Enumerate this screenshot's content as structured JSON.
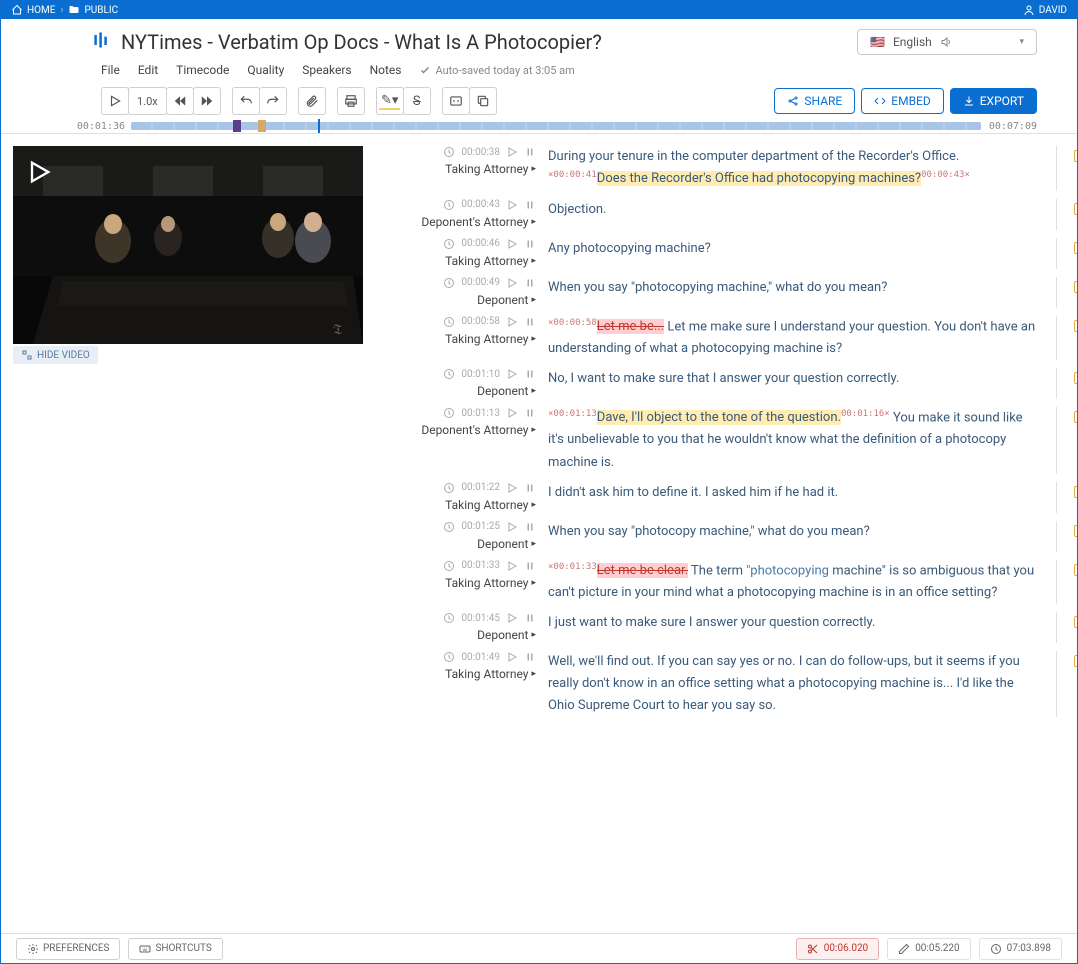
{
  "topbar": {
    "home": "HOME",
    "public": "PUBLIC",
    "user": "DAVID"
  },
  "header": {
    "title": "NYTimes - Verbatim Op Docs - What Is A Photocopier?",
    "language": "English",
    "menu": {
      "file": "File",
      "edit": "Edit",
      "timecode": "Timecode",
      "quality": "Quality",
      "speakers": "Speakers",
      "notes": "Notes"
    },
    "autosave": "Auto-saved today at 3:05 am",
    "speed": "1.0x",
    "actions": {
      "share": "SHARE",
      "embed": "EMBED",
      "export": "EXPORT"
    }
  },
  "timeline": {
    "current": "00:01:36",
    "duration": "00:07:09"
  },
  "video": {
    "hide": "HIDE VIDEO"
  },
  "segments": [
    {
      "tc": "00:00:38",
      "speaker": "Taking Attorney",
      "pre": "During your tenure in the computer department of the Recorder's Office. ",
      "ts1": "00:00:41",
      "hl": "Does the Recorder's Office had photocopying machines?",
      "ts2": "00:00:43"
    },
    {
      "tc": "00:00:43",
      "speaker": "Deponent's Attorney",
      "text": "Objection."
    },
    {
      "tc": "00:00:46",
      "speaker": "Taking Attorney",
      "text": "Any photocopying machine?"
    },
    {
      "tc": "00:00:49",
      "speaker": "Deponent",
      "text": "When you say \"photocopying machine,\" what do you mean?"
    },
    {
      "tc": "00:00:58",
      "speaker": "Taking Attorney",
      "ts1": "00:00:58",
      "strike": "Let me be...",
      "post": " Let me make sure I understand your question. You don't have an understanding of what a photocopying machine is?"
    },
    {
      "tc": "00:01:10",
      "speaker": "Deponent",
      "text": "No, I want to make sure that I answer your question correctly."
    },
    {
      "tc": "00:01:13",
      "speaker": "Deponent's Attorney",
      "ts1": "00:01:13",
      "hl": "Dave, I'll object to the tone of the question.",
      "ts2": "00:01:16",
      "post": " You make it sound like it's unbelievable to you that he wouldn't know what the definition of a photocopy machine is."
    },
    {
      "tc": "00:01:22",
      "speaker": "Taking Attorney",
      "text": "I didn't ask him to define it. I asked him if he had it."
    },
    {
      "tc": "00:01:25",
      "speaker": "Deponent",
      "text": "When you say \"photocopy machine,\" what do you mean?"
    },
    {
      "tc": "00:01:33",
      "speaker": "Taking Attorney",
      "ts1": "00:01:33",
      "strike": "Let me be clear.",
      "postquote": " The term ",
      "quote": "\"photocopying",
      "postquote2": " machine\" is so ambiguous that you can't picture in your mind what a photocopying machine is in an office setting?"
    },
    {
      "tc": "00:01:45",
      "speaker": "Deponent",
      "text": "I just want to make sure I answer your question correctly."
    },
    {
      "tc": "00:01:49",
      "speaker": "Taking Attorney",
      "text": "Well, we'll find out. If you can say yes or no. I can do follow-ups, but it seems if you really don't know in an office setting what a photocopying machine is... I'd like the Ohio Supreme Court to hear you say so."
    }
  ],
  "footer": {
    "preferences": "PREFERENCES",
    "shortcuts": "SHORTCUTS",
    "t1": "00:06.020",
    "t2": "00:05.220",
    "t3": "07:03.898"
  }
}
